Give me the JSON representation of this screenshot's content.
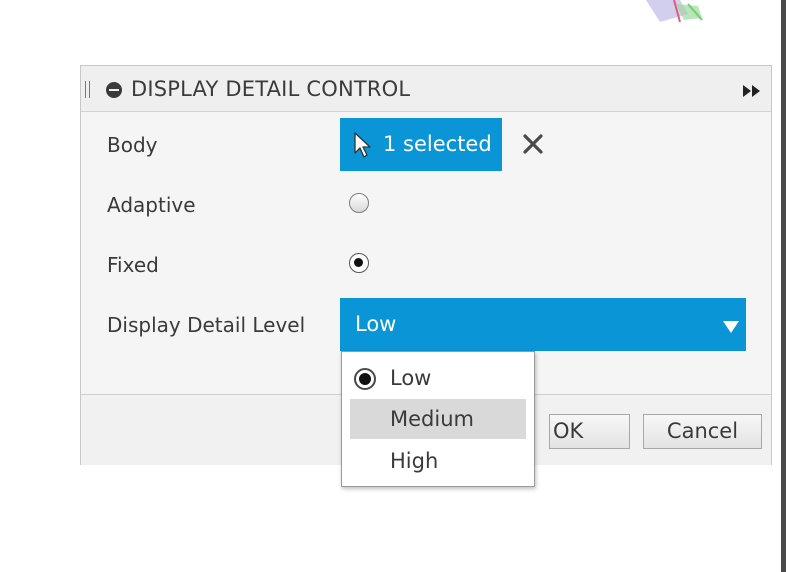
{
  "dialog": {
    "title": "DISPLAY DETAIL CONTROL"
  },
  "form": {
    "body_label": "Body",
    "body_selection": "1 selected",
    "adaptive_label": "Adaptive",
    "adaptive_checked": false,
    "fixed_label": "Fixed",
    "fixed_checked": true,
    "level_label": "Display Detail Level",
    "level_value": "Low"
  },
  "dropdown": {
    "options": [
      "Low",
      "Medium",
      "High"
    ],
    "selected": "Low",
    "hovered": "Medium"
  },
  "footer": {
    "ok_label": "OK",
    "cancel_label": "Cancel"
  },
  "colors": {
    "accent": "#0a96d6",
    "hover": "#d9d9d9"
  },
  "icons": {
    "grip": "grip-icon",
    "collapse": "collapse-icon",
    "expand": "double-chevron-right-icon",
    "cursor": "cursor-arrow-icon",
    "clear": "close-icon",
    "select_arrow": "triangle-down-icon"
  }
}
